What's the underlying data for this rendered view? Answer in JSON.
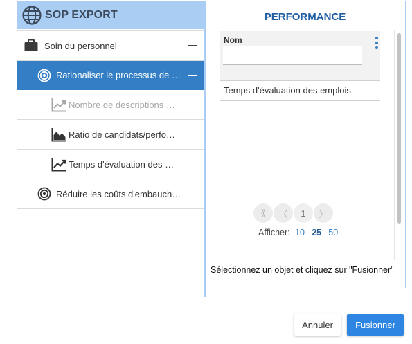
{
  "header": {
    "title": "SOP EXPORT",
    "icon": "globe-icon",
    "color": "#a9cdf3"
  },
  "tree": {
    "items": [
      {
        "label": "Soin du personnel",
        "icon": "briefcase-icon",
        "level": 0,
        "expanded": true
      },
      {
        "label": "Rationaliser le processus de r…",
        "icon": "target-icon",
        "level": 1,
        "expanded": true,
        "selected": true
      },
      {
        "label": "Nombre de descriptions é…",
        "icon": "line-chart-icon",
        "level": 2,
        "disabled": true
      },
      {
        "label": "Ratio de candidats/perfor…",
        "icon": "area-chart-icon",
        "level": 2
      },
      {
        "label": "Temps d'évaluation des e…",
        "icon": "line-chart-icon",
        "level": 2
      },
      {
        "label": "Réduire les coûts d'embauche…",
        "icon": "target-icon",
        "level": 1
      }
    ],
    "selected_color": "#337ec4"
  },
  "panel": {
    "title": "PERFORMANCE",
    "filter": {
      "label": "Nom",
      "value": "",
      "placeholder": ""
    },
    "menu_icon": "kebab-menu-icon",
    "results": [
      "Temps d'évaluation des emplois"
    ],
    "pager": {
      "first": "⟪",
      "prev": "〈",
      "current": "1",
      "next": "〉"
    },
    "page_size": {
      "label": "Afficher:",
      "options": [
        "10",
        "25",
        "50"
      ],
      "selected": "25",
      "separator": "-"
    },
    "instruction": "Sélectionnez un objet et cliquez sur \"Fusionner\""
  },
  "buttons": {
    "cancel": "Annuler",
    "merge": "Fusionner",
    "merge_color": "#2f86e2"
  }
}
